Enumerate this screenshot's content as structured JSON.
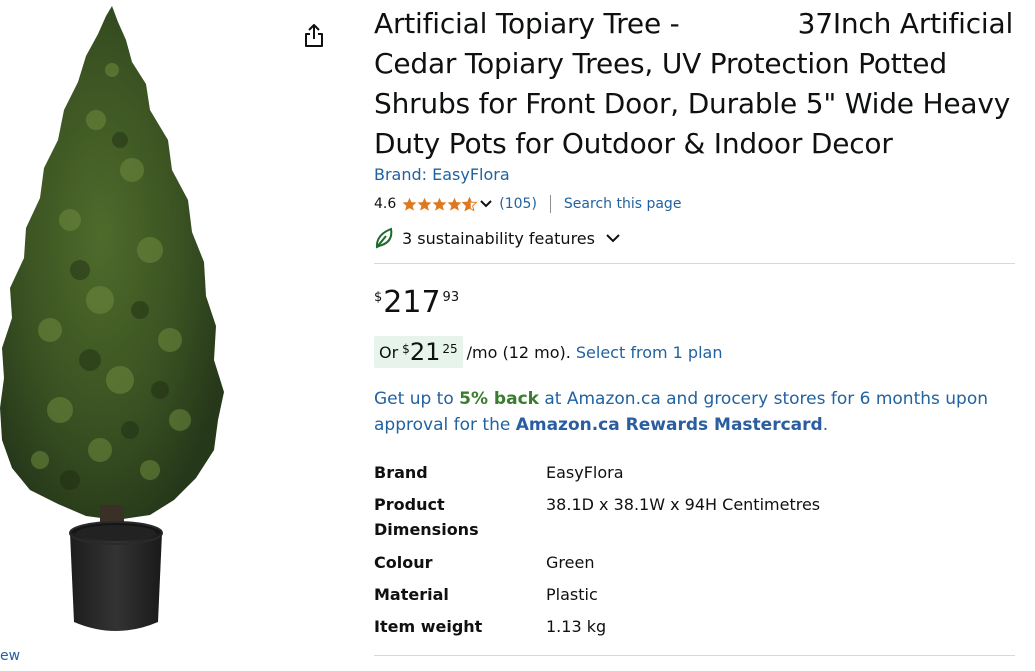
{
  "product": {
    "title_part1": "Artificial Topiary Tree -",
    "title_part2": "37Inch Artificial Cedar Topiary Trees, UV Protection Potted Shrubs for Front Door, Durable 5\" Wide Heavy Duty Pots for Outdoor & Indoor Decor",
    "brand_link": "Brand: EasyFlora"
  },
  "image": {
    "view_fragment": "ew",
    "share_icon": "share-icon"
  },
  "rating": {
    "value": "4.6",
    "stars": 4.6,
    "count": "(105)",
    "search_link": "Search this page"
  },
  "sustainability": {
    "label": "3 sustainability features",
    "icon": "leaf-icon"
  },
  "price": {
    "symbol": "$",
    "whole": "217",
    "fraction": "93"
  },
  "plan": {
    "or_label": "Or",
    "symbol": "$",
    "whole": "21",
    "fraction": "25",
    "per_month": "/mo (12 mo).",
    "select_link": "Select from 1 plan"
  },
  "promo": {
    "text1": "Get up to ",
    "percent": "5% back",
    "text2": " at Amazon.ca and grocery stores for 6 months upon approval for the ",
    "card": "Amazon.ca Rewards Mastercard",
    "text3": "."
  },
  "specs": [
    {
      "label": "Brand",
      "value": "EasyFlora"
    },
    {
      "label": "Product Dimensions",
      "value": "38.1D x 38.1W x 94H Centimetres"
    },
    {
      "label": "Colour",
      "value": "Green"
    },
    {
      "label": "Material",
      "value": "Plastic"
    },
    {
      "label": "Item weight",
      "value": "1.13 kg"
    }
  ],
  "colors": {
    "link": "#2162a1",
    "star": "#de7921",
    "promo_green": "#3a7d2e",
    "plan_badge_bg": "#e6f4eb"
  }
}
